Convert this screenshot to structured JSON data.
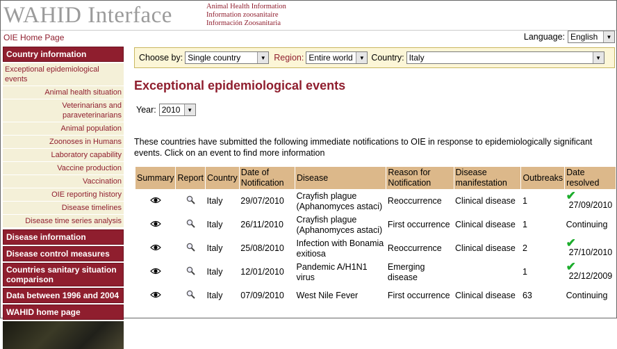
{
  "header": {
    "logo": "WAHID Interface",
    "taglines": [
      "Animal Health Information",
      "Information zoosanitaire",
      "Información Zoosanitaria"
    ]
  },
  "subbar": {
    "home_link": "OIE Home Page",
    "language_label": "Language:",
    "language_value": "English"
  },
  "sidebar": {
    "country_info_head": "Country information",
    "items": [
      "Exceptional epidemiological events",
      "Animal health situation",
      "Veterinarians and paraveterinarians",
      "Animal population",
      "Zoonoses in Humans",
      "Laboratory capability",
      "Vaccine production",
      "Vaccination",
      "OIE reporting history",
      "Disease timelines",
      "Disease time series analysis"
    ],
    "heads": [
      "Disease information",
      "Disease control measures",
      "Countries sanitary situation comparison",
      "Data between 1996 and 2004",
      "WAHID home page"
    ]
  },
  "chooser": {
    "choose_by_label": "Choose by:",
    "choose_by_value": "Single country",
    "region_label": "Region:",
    "region_value": "Entire world",
    "country_label": "Country:",
    "country_value": "Italy"
  },
  "main": {
    "title": "Exceptional epidemiological events",
    "year_label": "Year:",
    "year_value": "2010",
    "intro": "These countries have submitted the following immediate notifications to OIE in response to epidemiologically significant events. Click on an event to find more information"
  },
  "table": {
    "headers": [
      "Summary",
      "Report",
      "Country",
      "Date of Notification",
      "Disease",
      "Reason for Notification",
      "Disease manifestation",
      "Outbreaks",
      "Date resolved"
    ],
    "rows": [
      {
        "country": "Italy",
        "date": "29/07/2010",
        "disease": "Crayfish plague (Aphanomyces astaci)",
        "reason": "Reoccurrence",
        "manifestation": "Clinical disease",
        "outbreaks": "1",
        "resolved": "27/09/2010",
        "check": true
      },
      {
        "country": "Italy",
        "date": "26/11/2010",
        "disease": "Crayfish plague (Aphanomyces astaci)",
        "reason": "First occurrence",
        "manifestation": "Clinical disease",
        "outbreaks": "1",
        "resolved": "Continuing",
        "check": false
      },
      {
        "country": "Italy",
        "date": "25/08/2010",
        "disease": "Infection with Bonamia exitiosa",
        "reason": "Reoccurrence",
        "manifestation": "Clinical disease",
        "outbreaks": "2",
        "resolved": "27/10/2010",
        "check": true
      },
      {
        "country": "Italy",
        "date": "12/01/2010",
        "disease": "Pandemic A/H1N1 virus",
        "reason": "Emerging disease",
        "manifestation": "",
        "outbreaks": "1",
        "resolved": "22/12/2009",
        "check": true
      },
      {
        "country": "Italy",
        "date": "07/09/2010",
        "disease": "West Nile Fever",
        "reason": "First occurrence",
        "manifestation": "Clinical disease",
        "outbreaks": "63",
        "resolved": "Continuing",
        "check": false
      }
    ]
  },
  "colors": {
    "accent": "#8f1e2e",
    "table_header": "#dcb88a",
    "sidebar_item_bg": "#f4f0d8",
    "chooser_bg": "#fcf6d7",
    "check": "#1cad2c"
  }
}
